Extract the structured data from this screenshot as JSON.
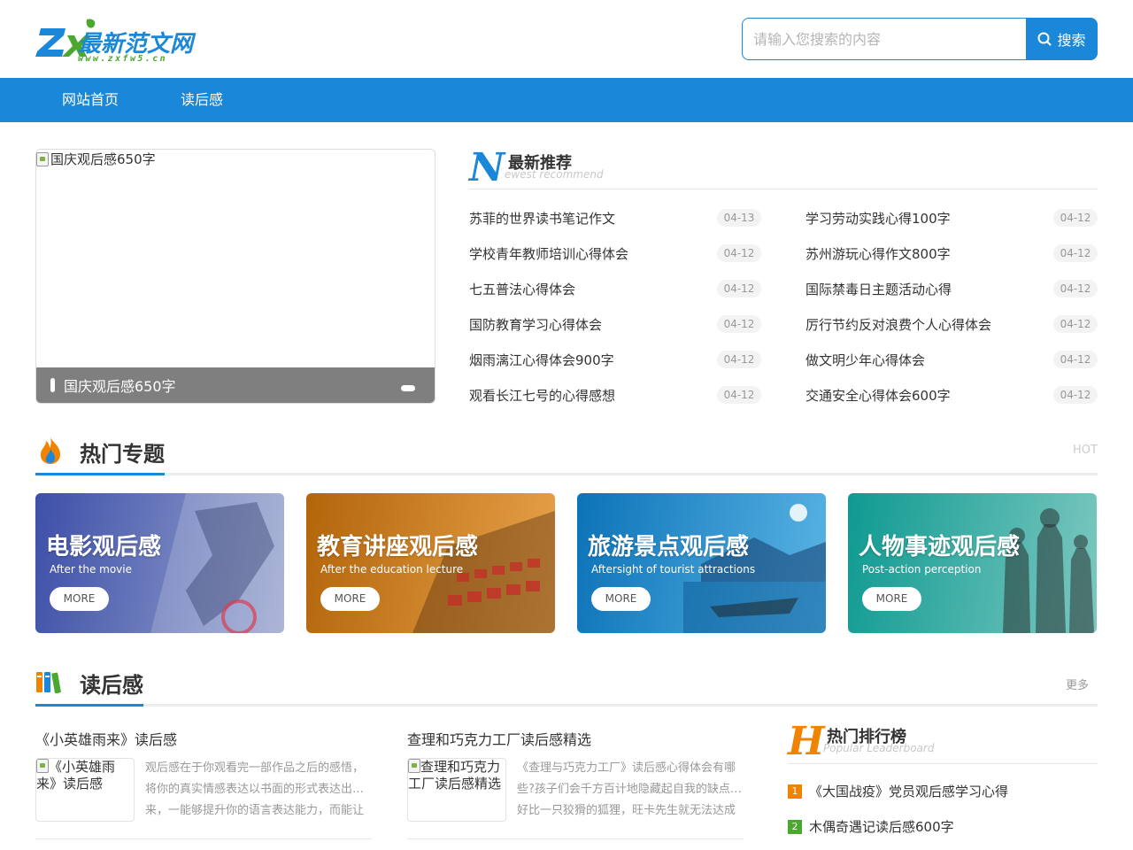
{
  "logo": {
    "brand_text": "最新范文网",
    "url_text": "www.zxfw5.cn",
    "mark": "ZX"
  },
  "search": {
    "placeholder": "请输入您搜索的内容",
    "button_label": "搜索"
  },
  "nav": {
    "items": [
      "网站首页",
      "读后感"
    ]
  },
  "slider": {
    "image_alt": "国庆观后感650字",
    "caption": "国庆观后感650字"
  },
  "recommend": {
    "letter": "N",
    "title": "最新推荐",
    "subtitle": "ewest recommend",
    "items": [
      {
        "title": "苏菲的世界读书笔记作文",
        "date": "04-13"
      },
      {
        "title": "学习劳动实践心得100字",
        "date": "04-12"
      },
      {
        "title": "学校青年教师培训心得体会",
        "date": "04-12"
      },
      {
        "title": "苏州游玩心得作文800字",
        "date": "04-12"
      },
      {
        "title": "七五普法心得体会",
        "date": "04-12"
      },
      {
        "title": "国际禁毒日主题活动心得",
        "date": "04-12"
      },
      {
        "title": "国防教育学习心得体会",
        "date": "04-12"
      },
      {
        "title": "厉行节约反对浪费个人心得体会",
        "date": "04-12"
      },
      {
        "title": "烟雨漓江心得体会900字",
        "date": "04-12"
      },
      {
        "title": "做文明少年心得体会",
        "date": "04-12"
      },
      {
        "title": "观看长江七号的心得感想",
        "date": "04-12"
      },
      {
        "title": "交通安全心得体会600字",
        "date": "04-12"
      }
    ]
  },
  "hot_topics": {
    "title": "热门专题",
    "tag": "HOT",
    "cards": [
      {
        "title": "电影观后感",
        "subtitle": "After the movie",
        "more": "MORE",
        "color_a": "#3d4fa8",
        "color_b": "#9aa6cf"
      },
      {
        "title": "教育讲座观后感",
        "subtitle": "After the education lecture",
        "more": "MORE",
        "color_a": "#b3650a",
        "color_b": "#e8a24a"
      },
      {
        "title": "旅游景点观后感",
        "subtitle": "Aftersight of tourist attractions",
        "more": "MORE",
        "color_a": "#0c73b8",
        "color_b": "#5ab4e4"
      },
      {
        "title": "人物事迹观后感",
        "subtitle": "Post-action perception",
        "more": "MORE",
        "color_a": "#0e9a91",
        "color_b": "#7cc8c0"
      }
    ]
  },
  "reviews": {
    "title": "读后感",
    "more": "更多",
    "articles": [
      {
        "title": "《小英雄雨来》读后感",
        "image_alt": "《小英雄雨来》读后感",
        "lines": [
          "观后感在于你观看完一部作品之后的感悟，",
          "将你的真实情感表达以书面的形式表达出…",
          "来，一能够提升你的语言表达能力，而能让"
        ]
      },
      {
        "title": "查理和巧克力工厂读后感精选",
        "image_alt": "查理和巧克力工厂读后感精选",
        "lines": [
          "《查理与巧克力工厂》读后感心得体会有哪",
          "些?孩子们会千方百计地隐藏起自我的缺点…",
          "好比一只狡猾的狐狸，旺卡先生就无法达成"
        ]
      }
    ]
  },
  "rank": {
    "letter": "H",
    "title": "热门排行榜",
    "subtitle": "Popular Leaderboard",
    "items": [
      {
        "num": "1",
        "title": "《大国战疫》党员观后感学习心得",
        "color": "#f08300"
      },
      {
        "num": "2",
        "title": "木偶奇遇记读后感600字",
        "color": "#4aa82e"
      }
    ]
  },
  "colors": {
    "primary": "#1a87d8",
    "letter_blue": "#1a87d8",
    "letter_orange": "#f08300"
  }
}
